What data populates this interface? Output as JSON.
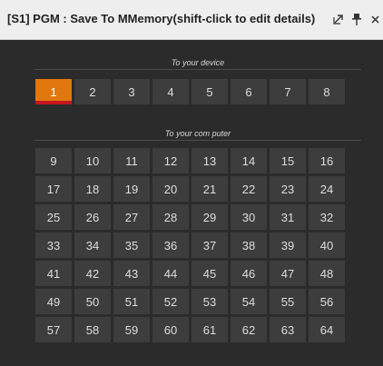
{
  "window": {
    "title": "[S1] PGM : Save To MMemory(shift-click to edit details)",
    "icons": [
      {
        "name": "popout-icon",
        "glyph": "⇱"
      },
      {
        "name": "pin-icon",
        "glyph": "⊥"
      },
      {
        "name": "close-icon",
        "glyph": "×"
      }
    ]
  },
  "device_section": {
    "header": "To your device",
    "buttons": [
      "1",
      "2",
      "3",
      "4",
      "5",
      "6",
      "7",
      "8"
    ],
    "selected": "1"
  },
  "computer_section": {
    "header": "To your com puter",
    "buttons": [
      "9",
      "10",
      "11",
      "12",
      "13",
      "14",
      "15",
      "16",
      "17",
      "18",
      "19",
      "20",
      "21",
      "22",
      "23",
      "24",
      "25",
      "26",
      "27",
      "28",
      "29",
      "30",
      "31",
      "32",
      "33",
      "34",
      "35",
      "36",
      "37",
      "38",
      "39",
      "40",
      "41",
      "42",
      "43",
      "44",
      "45",
      "46",
      "47",
      "48",
      "49",
      "50",
      "51",
      "52",
      "53",
      "54",
      "55",
      "56",
      "57",
      "58",
      "59",
      "60",
      "61",
      "62",
      "63",
      "64"
    ]
  },
  "colors": {
    "background": "#2b2b2b",
    "button": "#3d3d3d",
    "selected": "#e0780f",
    "tally": "#c4161c"
  }
}
